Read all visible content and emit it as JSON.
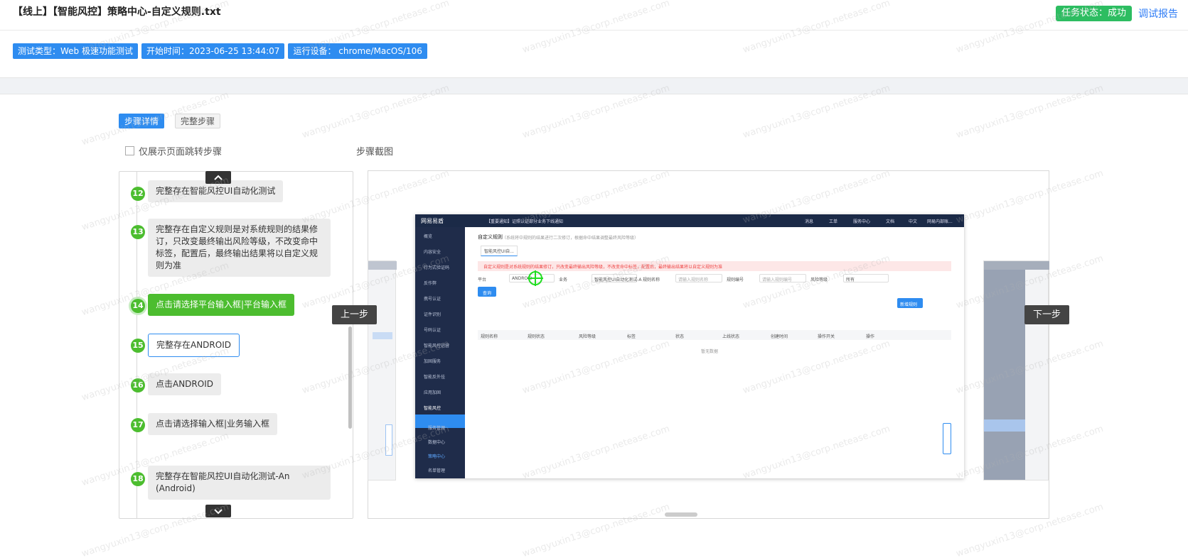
{
  "header": {
    "title": "【线上】【智能风控】策略中心-自定义规则.txt",
    "status_label": "任务状态：成功",
    "report_link": "调试报告",
    "tags": [
      "测试类型：Web 极速功能测试",
      "开始时间：2023-06-25 13:44:07",
      "运行设备： chrome/MacOS/106"
    ]
  },
  "tabs": {
    "details": "步骤详情",
    "full": "完整步骤"
  },
  "filter": {
    "checkbox_label": "仅展示页面跳转步骤",
    "checked": false
  },
  "screenshot_label": "步骤截图",
  "steps": [
    {
      "num": "12",
      "text": "完整存在智能风控UI自动化测试"
    },
    {
      "num": "13",
      "text": "完整存在自定义规则是对系统规则的结果修订，只改变最终输出风险等级，不改变命中标签，配置后，最终输出结果将以自定义规则为准"
    },
    {
      "num": "14",
      "text": "点击请选择平台输入框|平台输入框",
      "state": "active"
    },
    {
      "num": "15",
      "text": "完整存在ANDROID",
      "state": "hover"
    },
    {
      "num": "16",
      "text": "点击ANDROID"
    },
    {
      "num": "17",
      "text": "点击请选择输入框|业务输入框"
    },
    {
      "num": "18",
      "text": "完整存在智能风控UI自动化测试-An (Android)"
    }
  ],
  "nav": {
    "prev": "上一步",
    "next": "下一步"
  },
  "screenshot": {
    "logo": "网易易盾",
    "notice": "【重要通知】证照认证部分业务下线通知",
    "top_nav": [
      "消息",
      "工单",
      "服务中心",
      "文档",
      "中文",
      "网易内部账..."
    ],
    "sidebar": [
      "概览",
      "内容安全",
      "行为式验证码",
      "反作弊",
      "携号认证",
      "证件识别",
      "号码认证",
      "智能风控运营",
      "加固服务",
      "智能反外挂",
      "应用加固",
      "智能风控",
      "服务管理",
      "数据中心",
      "策略中心",
      "名单管理"
    ],
    "page_title": "自定义规则",
    "page_hint": "（系统将中规则的结果进行二次修订，根据命中结果调整最终风险等级）",
    "tab": "智能风控UI自...",
    "alert": "自定义规则是对系统规则的结果修订，只改变最终输出风险等级，不改变命中标签，配置后，最终输出结果将以自定义规则为准",
    "filters": [
      "平台",
      "ANDROID",
      "业务",
      "智能风控UI自动化测试-A",
      "规则名称",
      "请输入规则名称",
      "规则编号",
      "请输入规则编号",
      "风险等级",
      "所有"
    ],
    "search_btn": "查询",
    "add_btn": "新增规则",
    "columns": [
      "规则名称",
      "规则状态",
      "风险等级",
      "标签",
      "状态",
      "上线状态",
      "创建时间",
      "操作开关",
      "操作"
    ],
    "empty": "暂无数据"
  },
  "watermark": "wangyuxin13@corp.netease.com"
}
